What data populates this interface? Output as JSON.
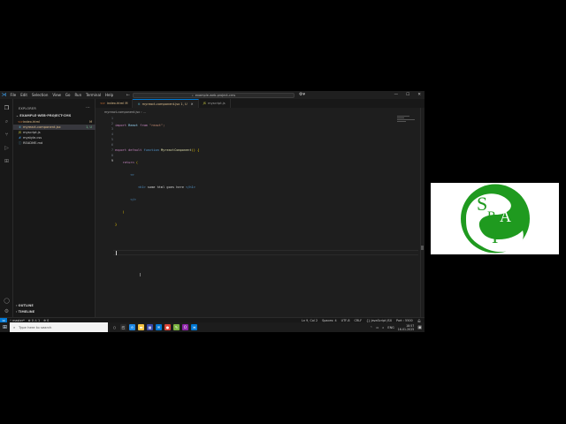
{
  "titlebar": {
    "menu": [
      "File",
      "Edit",
      "Selection",
      "View",
      "Go",
      "Run",
      "Terminal",
      "Help"
    ],
    "search": "example-web-project-cms",
    "icons": [
      "vscode-icon",
      "back-arrow-icon",
      "forward-arrow-icon",
      "copilot-icon",
      "minimize-icon",
      "maximize-icon",
      "close-icon"
    ]
  },
  "explorer": {
    "title": "EXPLORER",
    "folder": "EXAMPLE-WEB-PROJECT-CMS",
    "files": [
      {
        "name": "index.html",
        "badge": "M",
        "icon": "<>",
        "color": "#e37933"
      },
      {
        "name": "myreact-component.jsx",
        "badge": "1, U",
        "icon": "⚛",
        "color": "#61dafb"
      },
      {
        "name": "myscript.js",
        "badge": "",
        "icon": "JS",
        "color": "#cbcb41"
      },
      {
        "name": "mystyle.css",
        "badge": "",
        "icon": "#",
        "color": "#42a5f5"
      },
      {
        "name": "README.md",
        "badge": "",
        "icon": "ⓘ",
        "color": "#519aba"
      }
    ],
    "outline": "OUTLINE",
    "timeline": "TIMELINE"
  },
  "tabs": [
    {
      "label": "index.html M",
      "icon": "<>"
    },
    {
      "label": "myreact-component.jsx 1, U",
      "icon": "⚛"
    },
    {
      "label": "myscript.js",
      "icon": "JS"
    }
  ],
  "breadcrumb": "myreact-component.jsx ›  ...",
  "editor": {
    "line_numbers": [
      "1",
      "2",
      "3",
      "4",
      "5",
      "6",
      "7",
      "8",
      "9"
    ],
    "import_kw": "import",
    "import_id": "React",
    "from_kw": "from",
    "import_src": "\"react\";",
    "export_kw": "export default",
    "function_kw": "function",
    "fn_name": "MyreactComponent",
    "fn_sig": "() {",
    "return_kw": "return",
    "return_paren": "(",
    "jsx_open": "<>",
    "h1_open": "<h1>",
    "h1_text": " some html goes here ",
    "h1_close": "</h1>",
    "jsx_close": "</>",
    "close_paren": ")",
    "close_brace": "}"
  },
  "statusbar": {
    "branch": "master*",
    "problems": "⊗ 0 ⚠ 1",
    "ports": "⊕ 0",
    "position": "Ln 9, Col 2",
    "spaces": "Spaces: 4",
    "encoding": "UTF-8",
    "eol": "CRLF",
    "language": "{} JavaScript JSX",
    "port": "Port : 5500"
  },
  "taskbar": {
    "search_placeholder": "Type here to search",
    "apps": [
      {
        "name": "task-view-icon",
        "glyph": "◰",
        "color": "#2b2b2b"
      },
      {
        "name": "edge-icon",
        "glyph": "e",
        "color": "#1e88e5"
      },
      {
        "name": "file-explorer-icon",
        "glyph": "▬",
        "color": "#f6c343"
      },
      {
        "name": "store-icon",
        "glyph": "▦",
        "color": "#3949ab"
      },
      {
        "name": "mail-icon",
        "glyph": "✉",
        "color": "#0078d4"
      },
      {
        "name": "chrome-icon",
        "glyph": "●",
        "color": "#db4437"
      },
      {
        "name": "paint-icon",
        "glyph": "✎",
        "color": "#7cb342"
      },
      {
        "name": "opera-icon",
        "glyph": "O",
        "color": "#8e24aa"
      },
      {
        "name": "vscode-taskbar-icon",
        "glyph": "⋊",
        "color": "#0078d4"
      }
    ],
    "lang": "ENG",
    "time": "18:57",
    "date": "16-01-2025"
  },
  "logo": {
    "letters": [
      "S",
      "R",
      "A",
      "I"
    ],
    "green": "#1f9a1f"
  }
}
